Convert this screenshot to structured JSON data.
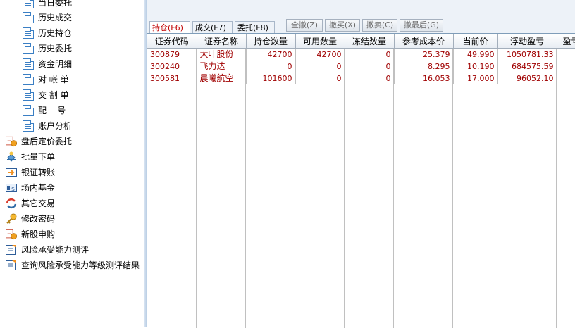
{
  "tree": {
    "items": [
      {
        "label": "当日委托",
        "icon": "document-icon"
      },
      {
        "label": "历史成交",
        "icon": "document-icon"
      },
      {
        "label": "历史持仓",
        "icon": "document-icon"
      },
      {
        "label": "历史委托",
        "icon": "document-icon"
      },
      {
        "label": "资金明细",
        "icon": "document-icon"
      },
      {
        "label": "对 帐 单",
        "icon": "document-icon"
      },
      {
        "label": "交 割 单",
        "icon": "document-icon"
      },
      {
        "label": "配    号",
        "icon": "document-icon"
      },
      {
        "label": "账户分析",
        "icon": "document-icon"
      },
      {
        "label": "盘后定价委托",
        "icon": "after-hours-icon"
      },
      {
        "label": "批量下单",
        "icon": "batch-order-icon"
      },
      {
        "label": "银证转账",
        "icon": "transfer-icon"
      },
      {
        "label": "场内基金",
        "icon": "fund-icon"
      },
      {
        "label": "其它交易",
        "icon": "exchange-icon"
      },
      {
        "label": "修改密码",
        "icon": "key-icon"
      },
      {
        "label": "新股申购",
        "icon": "ipo-icon"
      },
      {
        "label": "风险承受能力测评",
        "icon": "risk-test-icon"
      },
      {
        "label": "查询风险承受能力等级测评结果",
        "icon": "risk-result-icon"
      }
    ]
  },
  "tabs": [
    {
      "label": "持仓(F6)",
      "active": true
    },
    {
      "label": "成交(F7)",
      "active": false
    },
    {
      "label": "委托(F8)",
      "active": false
    }
  ],
  "actions": [
    {
      "label": "全撤(Z)"
    },
    {
      "label": "撤买(X)"
    },
    {
      "label": "撤卖(C)"
    },
    {
      "label": "撤最后(G)"
    }
  ],
  "table": {
    "headers": [
      "证券代码",
      "证券名称",
      "持仓数量",
      "可用数量",
      "冻结数量",
      "参考成本价",
      "当前价",
      "浮动盈亏",
      "盈亏"
    ],
    "rows": [
      [
        "300879",
        "大叶股份",
        "42700",
        "42700",
        "0",
        "25.379",
        "49.990",
        "1050781.33"
      ],
      [
        "300240",
        "飞力达",
        "0",
        "0",
        "0",
        "8.295",
        "10.190",
        "684575.59"
      ],
      [
        "300581",
        "晨曦航空",
        "101600",
        "0",
        "0",
        "16.053",
        "17.000",
        "96052.10"
      ]
    ]
  },
  "colors": {
    "accent": "#c00000",
    "row_text": "#a00000",
    "header_bg": "#e8edf3",
    "panel_bg": "#edf2f8"
  }
}
